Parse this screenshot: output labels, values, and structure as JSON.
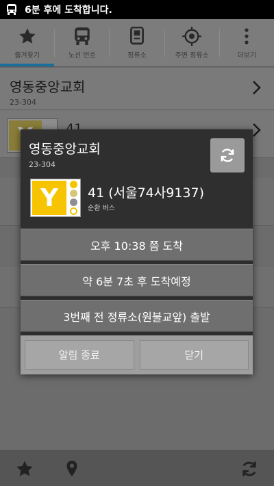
{
  "status_bar": {
    "notification": "6분 후에 도착합니다."
  },
  "tabs": [
    {
      "label": "즐겨찾기",
      "icon": "star-icon",
      "active": true
    },
    {
      "label": "노선 번호",
      "icon": "bus-icon"
    },
    {
      "label": "정류소",
      "icon": "bus-stop-icon"
    },
    {
      "label": "주변 정류소",
      "icon": "location-target-icon"
    },
    {
      "label": "더보기",
      "icon": "more-vert-icon"
    }
  ],
  "list": {
    "stop": {
      "name": "영동중앙교회",
      "code": "23-304"
    },
    "route_partial": "41"
  },
  "dialog": {
    "stop_name": "영동중앙교회",
    "stop_code": "23-304",
    "route": "41 (서울74사9137)",
    "route_type": "순환 버스",
    "logo_letter": "Y",
    "arrival_time": "오후 10:38 쯤 도착",
    "eta": "약 6분 7초 후 도착예정",
    "departure_info": "3번째 전 정류소(원불교앞) 출발",
    "buttons": {
      "stop_alarm": "알림 종료",
      "close": "닫기"
    }
  },
  "colors": {
    "accent_tab": "#1c6f9a",
    "bus_yellow": "#f6c400"
  }
}
